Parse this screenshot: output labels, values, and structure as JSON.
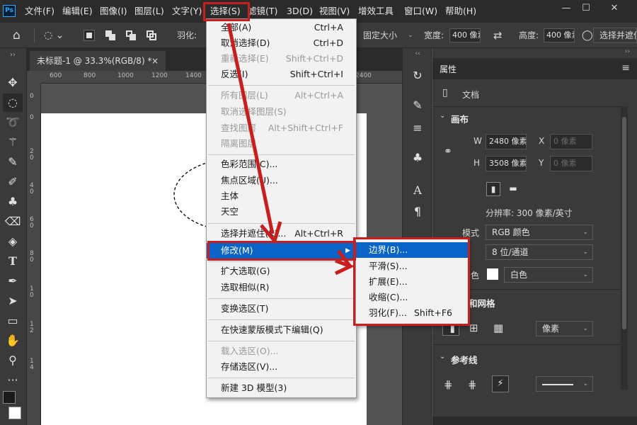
{
  "app": {
    "logo": "Ps"
  },
  "menubar": {
    "items": [
      "文件(F)",
      "编辑(E)",
      "图像(I)",
      "图层(L)",
      "文字(Y)",
      "选择(S)",
      "滤镜(T)",
      "3D(D)",
      "视图(V)",
      "增效工具",
      "窗口(W)",
      "帮助(H)"
    ],
    "window_controls": {
      "minimize": "—",
      "maximize": "☐",
      "close": "✕"
    }
  },
  "options_bar": {
    "feather_label": "羽化:",
    "style_value": "固定大小",
    "width_label": "宽度:",
    "width_value": "400 像素",
    "height_label": "高度:",
    "height_value": "400 像素",
    "select_and_mask": "选择并遮住..."
  },
  "document": {
    "tab_title": "未标题-1 @ 33.3%(RGB/8) *",
    "tab_close": "×",
    "ruler_h": [
      "600",
      "800",
      "1000",
      "1200",
      "1400",
      "2400"
    ],
    "ruler_v": [
      "0",
      "0",
      "2\n0",
      "4\n0",
      "6\n0",
      "8\n0",
      "1\n0",
      "1\n2",
      "1\n4"
    ]
  },
  "select_menu": {
    "items": [
      {
        "label": "全部(A)",
        "shortcut": "Ctrl+A",
        "disabled": false
      },
      {
        "label": "取消选择(D)",
        "shortcut": "Ctrl+D",
        "disabled": false
      },
      {
        "label": "重新选择(E)",
        "shortcut": "Shift+Ctrl+D",
        "disabled": true
      },
      {
        "label": "反选(I)",
        "shortcut": "Shift+Ctrl+I",
        "disabled": false
      },
      {
        "label": "所有图层(L)",
        "shortcut": "Alt+Ctrl+A",
        "disabled": true
      },
      {
        "label": "取消选择图层(S)",
        "shortcut": "",
        "disabled": true
      },
      {
        "label": "查找图层",
        "shortcut": "Alt+Shift+Ctrl+F",
        "disabled": true
      },
      {
        "label": "隔离图层",
        "shortcut": "",
        "disabled": true
      },
      {
        "label": "色彩范围(C)...",
        "shortcut": "",
        "disabled": false
      },
      {
        "label": "焦点区域(U)...",
        "shortcut": "",
        "disabled": false
      },
      {
        "label": "主体",
        "shortcut": "",
        "disabled": false
      },
      {
        "label": "天空",
        "shortcut": "",
        "disabled": false
      },
      {
        "label": "选择并遮住(K)...",
        "shortcut": "Alt+Ctrl+R",
        "disabled": false
      },
      {
        "label": "修改(M)",
        "shortcut": "",
        "disabled": false
      },
      {
        "label": "扩大选取(G)",
        "shortcut": "",
        "disabled": false
      },
      {
        "label": "选取相似(R)",
        "shortcut": "",
        "disabled": false
      },
      {
        "label": "变换选区(T)",
        "shortcut": "",
        "disabled": false
      },
      {
        "label": "在快速蒙版模式下编辑(Q)",
        "shortcut": "",
        "disabled": false
      },
      {
        "label": "载入选区(O)...",
        "shortcut": "",
        "disabled": true
      },
      {
        "label": "存储选区(V)...",
        "shortcut": "",
        "disabled": false
      },
      {
        "label": "新建 3D 模型(3)",
        "shortcut": "",
        "disabled": false
      }
    ]
  },
  "modify_submenu": {
    "items": [
      {
        "label": "边界(B)...",
        "shortcut": ""
      },
      {
        "label": "平滑(S)...",
        "shortcut": ""
      },
      {
        "label": "扩展(E)...",
        "shortcut": ""
      },
      {
        "label": "收缩(C)...",
        "shortcut": ""
      },
      {
        "label": "羽化(F)...",
        "shortcut": "Shift+F6"
      }
    ]
  },
  "properties": {
    "tab": "属性",
    "doc_label": "文档",
    "canvas_section": "画布",
    "w_label": "W",
    "w_value": "2480 像素",
    "x_label": "X",
    "x_value": "0 像素",
    "h_label": "H",
    "h_value": "3508 像素",
    "y_label": "Y",
    "y_value": "0 像素",
    "resolution": "分辨率: 300 像素/英寸",
    "mode_label": "模式",
    "mode_value": "RGB 颜色",
    "depth_value": "8 位/通道",
    "bg_label": "背景色",
    "bg_value": "白色",
    "rulers_section": "标尺和网格",
    "units_value": "像素",
    "guides_section": "参考线"
  },
  "colors": {
    "highlight": "#0a64c8",
    "annotation_red": "#c81e1e",
    "ps_blue": "#31a8ff"
  }
}
